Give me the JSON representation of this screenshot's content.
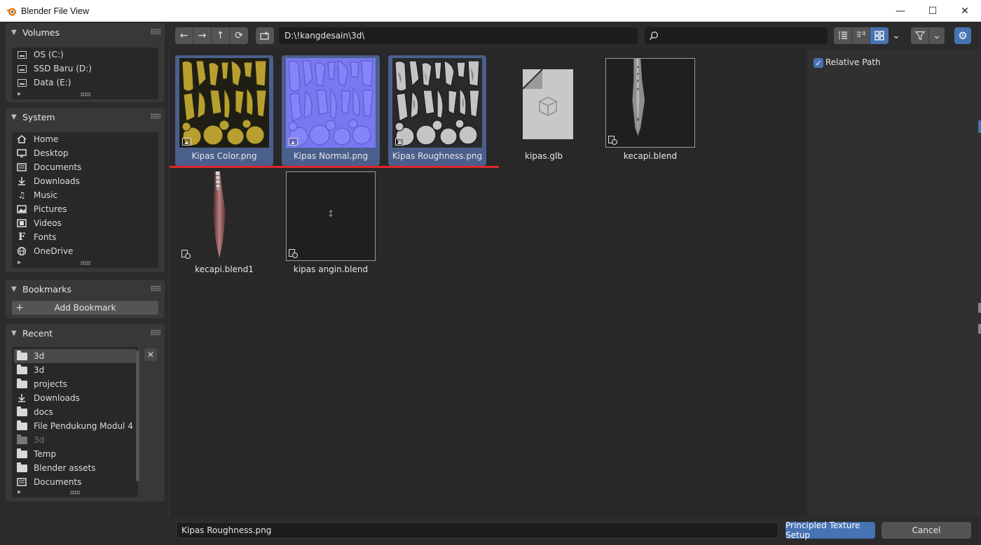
{
  "window": {
    "title": "Blender File View",
    "minimize": "—",
    "maximize": "☐",
    "close": "✕"
  },
  "sidebar": {
    "volumes": {
      "title": "Volumes",
      "items": [
        {
          "label": "OS (C:)",
          "icon": "drive-icon"
        },
        {
          "label": "SSD Baru (D:)",
          "icon": "drive-icon"
        },
        {
          "label": "Data (E:)",
          "icon": "drive-icon"
        }
      ]
    },
    "system": {
      "title": "System",
      "items": [
        {
          "label": "Home",
          "icon": "home-icon"
        },
        {
          "label": "Desktop",
          "icon": "desktop-icon"
        },
        {
          "label": "Documents",
          "icon": "documents-icon"
        },
        {
          "label": "Downloads",
          "icon": "download-icon"
        },
        {
          "label": "Music",
          "icon": "music-icon"
        },
        {
          "label": "Pictures",
          "icon": "pictures-icon"
        },
        {
          "label": "Videos",
          "icon": "videos-icon"
        },
        {
          "label": "Fonts",
          "icon": "fonts-icon"
        },
        {
          "label": "OneDrive",
          "icon": "globe-icon"
        }
      ]
    },
    "bookmarks": {
      "title": "Bookmarks",
      "add_label": "Add Bookmark"
    },
    "recent": {
      "title": "Recent",
      "items": [
        {
          "label": "3d",
          "icon": "folder-icon",
          "selected": true
        },
        {
          "label": "3d",
          "icon": "folder-icon"
        },
        {
          "label": "projects",
          "icon": "folder-icon"
        },
        {
          "label": "Downloads",
          "icon": "download-icon"
        },
        {
          "label": "docs",
          "icon": "folder-icon"
        },
        {
          "label": "File Pendukung Modul 4",
          "icon": "folder-icon"
        },
        {
          "label": "3d",
          "icon": "folder-icon",
          "dim": true
        },
        {
          "label": "Temp",
          "icon": "folder-icon"
        },
        {
          "label": "Blender assets",
          "icon": "folder-icon"
        },
        {
          "label": "Documents",
          "icon": "documents-icon"
        }
      ]
    }
  },
  "toolbar": {
    "path": "D:\\!kangdesain\\3d\\",
    "search_placeholder": ""
  },
  "files": [
    {
      "name": "Kipas Color.png",
      "type": "image",
      "selected": true,
      "tint": "#b8a030"
    },
    {
      "name": "Kipas Normal.png",
      "type": "image",
      "selected": true,
      "tint": "#8080f8"
    },
    {
      "name": "Kipas Roughness.png",
      "type": "image",
      "selected": true,
      "tint": "#bdbdbd"
    },
    {
      "name": "kipas.glb",
      "type": "generic",
      "selected": false
    },
    {
      "name": "kecapi.blend",
      "type": "blend",
      "selected": false
    },
    {
      "name": "kecapi.blend1",
      "type": "blend1",
      "selected": false
    },
    {
      "name": "kipas angin.blend",
      "type": "blend-empty",
      "selected": false
    }
  ],
  "options": {
    "relative_path_label": "Relative Path",
    "relative_path_checked": true
  },
  "footer": {
    "filename": "Kipas Roughness.png",
    "confirm_label": "Principled Texture Setup",
    "cancel_label": "Cancel"
  },
  "colors": {
    "accent": "#4772b3",
    "annotation": "#e0262b"
  }
}
